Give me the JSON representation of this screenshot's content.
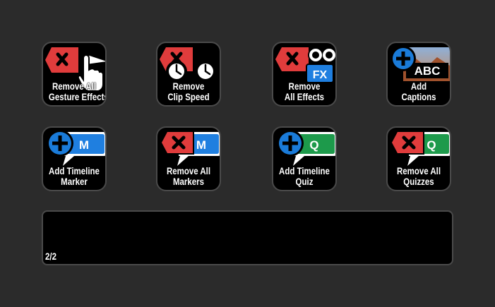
{
  "keys": [
    {
      "line1": "Remove All",
      "line2": "Gesture Effects"
    },
    {
      "line1": "Remove",
      "line2": "Clip Speed"
    },
    {
      "line1": "Remove",
      "line2": "All Effects"
    },
    {
      "line1": "Add",
      "line2": "Captions"
    },
    {
      "line1": "Add Timeline",
      "line2": "Marker"
    },
    {
      "line1": "Remove All",
      "line2": "Markers"
    },
    {
      "line1": "Add Timeline",
      "line2": "Quiz"
    },
    {
      "line1": "Remove All",
      "line2": "Quizzes"
    }
  ],
  "badges": {
    "fx": "FX",
    "abc": "ABC",
    "marker": "M",
    "quiz": "Q"
  },
  "colors": {
    "remove_red": "#e03c3c",
    "add_blue": "#1a7bd9",
    "marker_blue": "#1f7fe0",
    "quiz_green": "#1d9a4b",
    "background": "#2b2b2b"
  },
  "icons": [
    "remove-x-icon",
    "hand-pointer-icon",
    "clock-icon",
    "infinity-icon",
    "plus-circle-icon",
    "speech-bubble-icon"
  ],
  "pager": {
    "text": "2/2"
  }
}
